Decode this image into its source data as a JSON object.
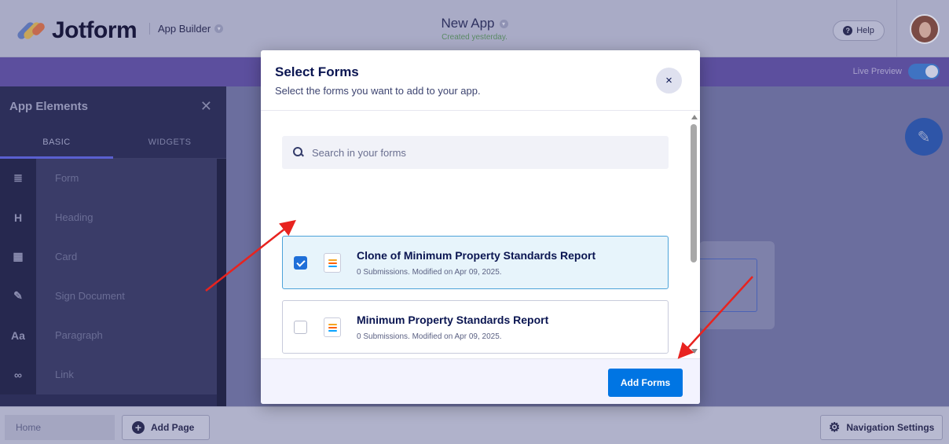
{
  "app": {
    "brand": "Jotform",
    "builder_label": "App Builder",
    "app_title": "New App",
    "app_subtitle": "Created yesterday.",
    "help_label": "Help",
    "live_preview_label": "Live Preview"
  },
  "sidebar": {
    "title": "App Elements",
    "tabs": [
      {
        "label": "BASIC",
        "active": true
      },
      {
        "label": "WIDGETS",
        "active": false
      }
    ],
    "items": [
      {
        "label": "Form",
        "icon": "form-icon",
        "glyph": "≣"
      },
      {
        "label": "Heading",
        "icon": "heading-icon",
        "glyph": "H"
      },
      {
        "label": "Card",
        "icon": "card-icon",
        "glyph": "▦"
      },
      {
        "label": "Sign Document",
        "icon": "sign-document-icon",
        "glyph": "✎"
      },
      {
        "label": "Paragraph",
        "icon": "paragraph-icon",
        "glyph": "Aa"
      },
      {
        "label": "Link",
        "icon": "link-icon",
        "glyph": "∞"
      }
    ]
  },
  "bottom": {
    "home_label": "Home",
    "add_page_label": "Add Page",
    "nav_settings_label": "Navigation Settings"
  },
  "modal": {
    "title": "Select Forms",
    "subtitle": "Select the forms you want to add to your app.",
    "close_label": "×",
    "search_placeholder": "Search in your forms",
    "forms": [
      {
        "name": "Clone of Minimum Property Standards Report",
        "meta": "0 Submissions. Modified on Apr 09, 2025.",
        "checked": true
      },
      {
        "name": "Minimum Property Standards Report",
        "meta": "0 Submissions. Modified on Apr 09, 2025.",
        "checked": false
      }
    ],
    "add_button_label": "Add Forms"
  },
  "colors": {
    "primary_button": "#0075e3",
    "selected_card_bg": "#e7f4fb",
    "annotation_arrow": "#e8231f"
  }
}
